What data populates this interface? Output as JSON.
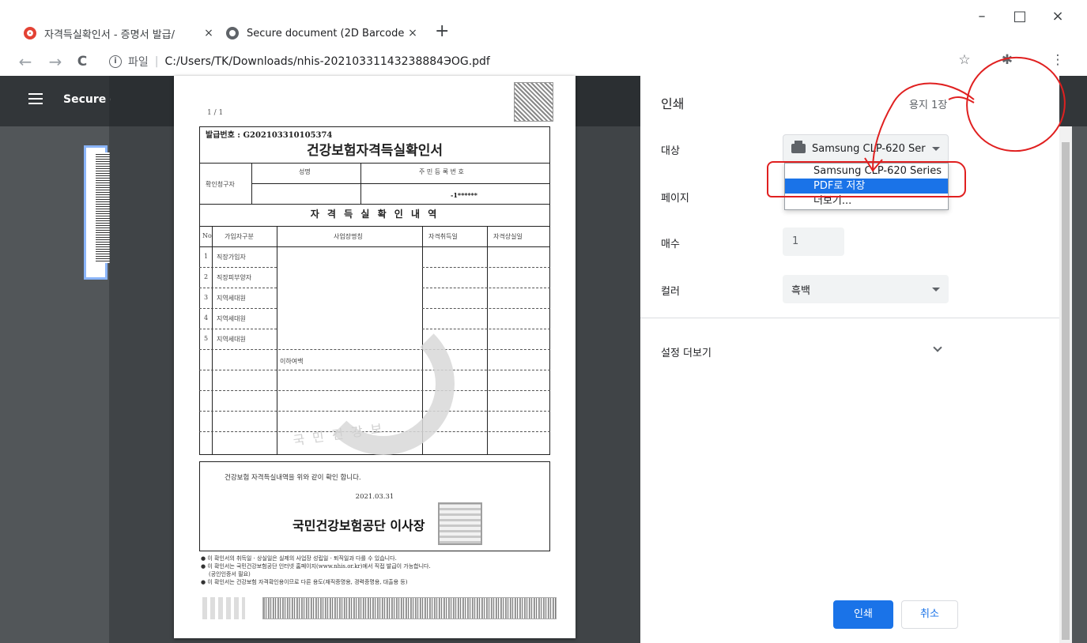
{
  "browser": {
    "tabs": [
      {
        "title": "자격득실확인서 - 증명서 발급/",
        "close": "×",
        "icon": "red-o-favicon"
      },
      {
        "title": "Secure document (2D Barcode)",
        "close": "×",
        "icon": "globe-favicon"
      }
    ],
    "new_tab": "+",
    "window_controls": {
      "minimize": "–",
      "maximize": "□",
      "close": "×"
    },
    "nav": {
      "back": "←",
      "forward": "→",
      "reload": "C"
    },
    "address": {
      "scheme_icon": "i",
      "scheme_label": "파일",
      "separator": "|",
      "url": "C:/Users/TK/Downloads/nhis-20210331143238884ЭOG.pdf"
    },
    "bar_icons": {
      "bookmark": "☆",
      "extensions": "✱",
      "menu": "⋮"
    }
  },
  "viewer": {
    "title": "Secure d",
    "toolbar_icons": {
      "download": "⭳",
      "print": "⎙",
      "more": "⋮"
    }
  },
  "document": {
    "page_num": "1 / 1",
    "doc_no_label": "발급번호 :",
    "doc_no": "G202103310105374",
    "title": "건강보험자격득실확인서",
    "requester_label": "확인청구자",
    "name_header": "성명",
    "rrn_header": "주 민 등 록 번 호",
    "rrn_value": "-1******",
    "section_title": "자 격 득 실 확 인 내 역",
    "columns": [
      "No",
      "가입자구분",
      "사업장명칭",
      "자격취득일",
      "자격상실일"
    ],
    "rows": [
      {
        "no": "1",
        "type": "직장가입자"
      },
      {
        "no": "2",
        "type": "직장피부양자"
      },
      {
        "no": "3",
        "type": "지역세대원"
      },
      {
        "no": "4",
        "type": "지역세대원"
      },
      {
        "no": "5",
        "type": "지역세대원"
      }
    ],
    "blank_row_text": "이하여백",
    "seal_text": "국민건강보",
    "confirm_text": "건강보험 자격득실내역을 위와 같이 확인 합니다.",
    "confirm_date": "2021.03.31",
    "issuer": "국민건강보험공단 이사장",
    "notes": [
      "● 이 확인서의 취득일 · 상실일은 실제의 사업장 성립일 · 퇴직일과 다를 수 있습니다.",
      "● 이 확인서는 국민건강보험공단 인터넷 홈페이지(www.nhis.or.kr)에서 직접 발급이 가능합니다.",
      "(공인인증서 필요)",
      "● 이 확인서는 건강보험 자격확인용이므로 다른 용도(재직증명용, 경력증명용, 대출용 등)"
    ]
  },
  "print": {
    "title": "인쇄",
    "sheets": "용지 1장",
    "destination_label": "대상",
    "destination_value": "Samsung CLP-620 Ser",
    "destination_options": [
      "Samsung CLP-620 Series",
      "PDF로 저장",
      "더보기..."
    ],
    "selected_option_index": 1,
    "pages_label": "페이지",
    "copies_label": "매수",
    "copies_value": "1",
    "color_label": "컬러",
    "color_value": "흑백",
    "more_settings_label": "설정 더보기",
    "print_button": "인쇄",
    "cancel_button": "취소"
  },
  "colors": {
    "accent": "#1a73e8",
    "toolbar_dark": "#323639",
    "viewer_bg": "#525659",
    "annotation": "#e02020"
  }
}
